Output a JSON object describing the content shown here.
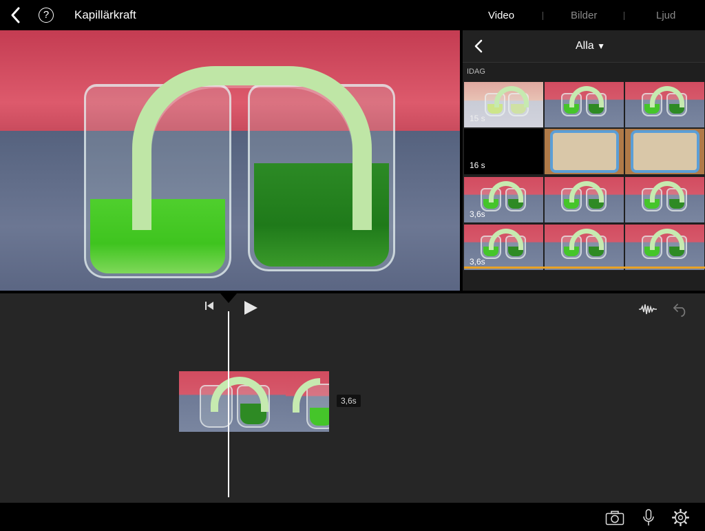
{
  "header": {
    "project_title": "Kapillärkraft",
    "help_icon_label": "?",
    "tabs": [
      {
        "label": "Video",
        "active": true
      },
      {
        "label": "Bilder",
        "active": false
      },
      {
        "label": "Ljud",
        "active": false
      }
    ]
  },
  "browser": {
    "filter_label": "Alla",
    "section_label": "IDAG",
    "clips": [
      {
        "duration": "15 s"
      },
      {
        "duration": "16 s"
      },
      {
        "duration": "3,6s"
      },
      {
        "duration": "3,6s"
      }
    ]
  },
  "timeline": {
    "clip_duration": "3,6s"
  },
  "icons": {
    "back": "chevron-left-icon",
    "help": "question-circle-icon",
    "filter": "triangle-down-icon",
    "skip_start": "skip-to-start-icon",
    "play": "play-icon",
    "audio": "waveform-icon",
    "undo": "undo-icon",
    "camera": "camera-icon",
    "mic": "microphone-icon",
    "settings": "gear-icon"
  },
  "colors": {
    "accent_used": "#e9a225",
    "background": "#262626"
  }
}
